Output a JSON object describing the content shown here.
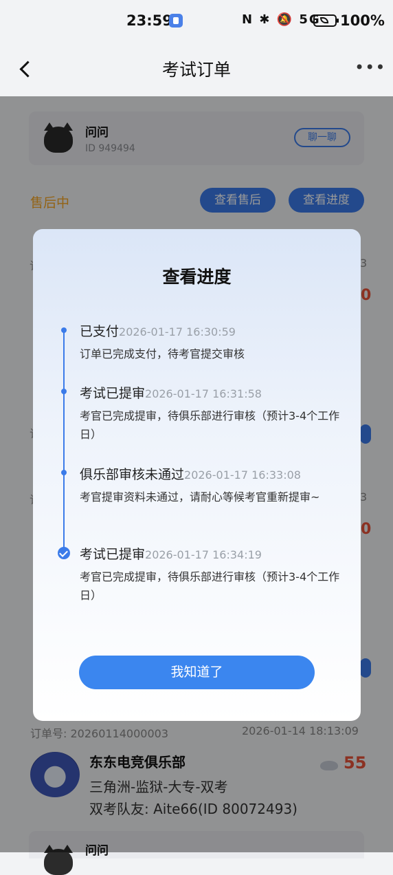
{
  "status_bar": {
    "time": "23:59",
    "icons": "N ✱ 🔕 5G",
    "battery": "100%"
  },
  "nav": {
    "title": "考试订单"
  },
  "background": {
    "card": {
      "name": "问问",
      "id": "ID 949494",
      "chat_label": "聊一聊"
    },
    "status": "售后中",
    "btn_aftersale": "查看售后",
    "btn_progress": "查看进度",
    "order": {
      "no": "订单号: 20260114000003",
      "time": "2026-01-14 18:13:09"
    },
    "club": {
      "name": "东东电竞俱乐部",
      "line1": "三角洲-监狱-大专-双考",
      "line2": "双考队友: Aite66(ID 80072493)",
      "score": "55"
    },
    "card2_name": "问问",
    "edge_digit_a": "3",
    "edge_digit_b": "0",
    "edge_digit_c": "3",
    "edge_digit_d": "0",
    "edge_letter_a": "订",
    "edge_letter_b": "订",
    "edge_letter_c": "订"
  },
  "modal": {
    "title": "查看进度",
    "steps": [
      {
        "title": "已支付",
        "time": "2026-01-17 16:30:59",
        "desc": "订单已完成支付，待考官提交审核"
      },
      {
        "title": "考试已提审",
        "time": "2026-01-17 16:31:58",
        "desc": "考官已完成提审，待俱乐部进行审核（预计3-4个工作日）"
      },
      {
        "title": "俱乐部审核未通过",
        "time": "2026-01-17 16:33:08",
        "desc": "考官提审资料未通过，请耐心等候考官重新提审~"
      },
      {
        "title": "考试已提审",
        "time": "2026-01-17 16:34:19",
        "desc": "考官已完成提审，待俱乐部进行审核（预计3-4个工作日）"
      }
    ],
    "confirm_label": "我知道了"
  }
}
